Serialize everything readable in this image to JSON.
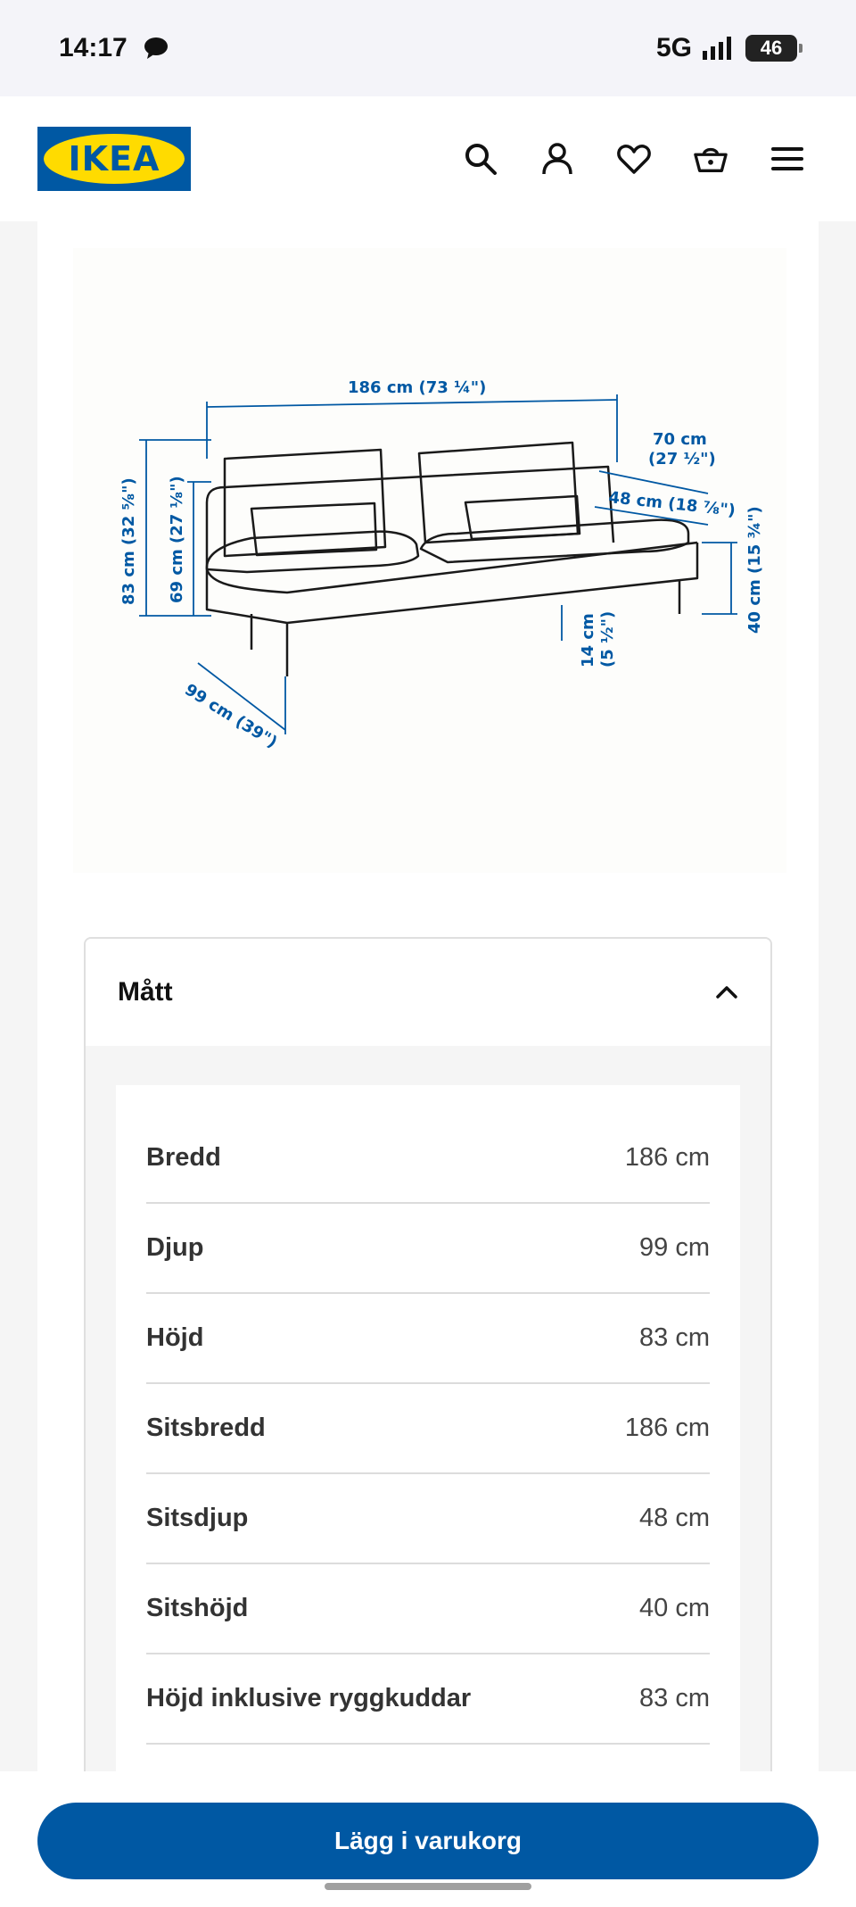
{
  "status_bar": {
    "time": "14:17",
    "network": "5G",
    "battery": "46",
    "icons": [
      "chat-bubble-icon",
      "signal-icon",
      "battery-icon"
    ]
  },
  "header": {
    "logo_text": "IKEA",
    "icons": [
      "search-icon",
      "profile-icon",
      "heart-icon",
      "basket-icon",
      "menu-icon"
    ]
  },
  "diagram": {
    "labels": {
      "width": "186 cm (73 ¼\")",
      "back_depth_cm": "70 cm",
      "back_depth_in": "(27 ½\")",
      "seat_depth": "48 cm (18 ⅞\")",
      "height": "83 cm (32 ⅝\")",
      "arm_height": "69 cm (27 ⅛\")",
      "seat_height": "40 cm (15 ¾\")",
      "leg_cm": "14 cm",
      "leg_in": "(5 ½\")",
      "depth": "99 cm (39\")"
    }
  },
  "dimensions": {
    "title": "Mått",
    "rows": [
      {
        "label": "Bredd",
        "value": "186 cm"
      },
      {
        "label": "Djup",
        "value": "99 cm"
      },
      {
        "label": "Höjd",
        "value": "83 cm"
      },
      {
        "label": "Sitsbredd",
        "value": "186 cm"
      },
      {
        "label": "Sitsdjup",
        "value": "48 cm"
      },
      {
        "label": "Sitshöjd",
        "value": "40 cm"
      },
      {
        "label": "Höjd inklusive ryggkuddar",
        "value": "83 cm"
      }
    ]
  },
  "cta": {
    "add_to_cart": "Lägg i varukorg"
  },
  "colors": {
    "brand_blue": "#0058a3",
    "brand_yellow": "#ffdb00"
  }
}
